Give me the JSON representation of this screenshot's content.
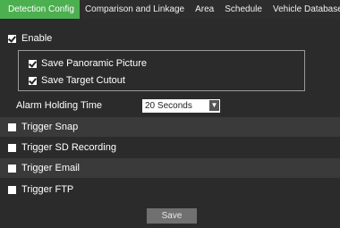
{
  "tabs": [
    {
      "label": "Detection Config",
      "active": true
    },
    {
      "label": "Comparison and Linkage",
      "active": false
    },
    {
      "label": "Area",
      "active": false
    },
    {
      "label": "Schedule",
      "active": false
    },
    {
      "label": "Vehicle Database",
      "active": false
    }
  ],
  "enable": {
    "label": "Enable",
    "checked": true
  },
  "group": {
    "save_panoramic": {
      "label": "Save Panoramic Picture",
      "checked": true
    },
    "save_target": {
      "label": "Save Target Cutout",
      "checked": true
    }
  },
  "alarm_holding": {
    "label": "Alarm Holding Time",
    "value": "20 Seconds"
  },
  "triggers": [
    {
      "label": "Trigger Snap",
      "checked": false
    },
    {
      "label": "Trigger SD Recording",
      "checked": false
    },
    {
      "label": "Trigger Email",
      "checked": false
    },
    {
      "label": "Trigger FTP",
      "checked": false
    }
  ],
  "save_label": "Save",
  "colors": {
    "accent": "#4caf50",
    "background": "#2b2b2b",
    "row_light": "#3a3a3a"
  }
}
